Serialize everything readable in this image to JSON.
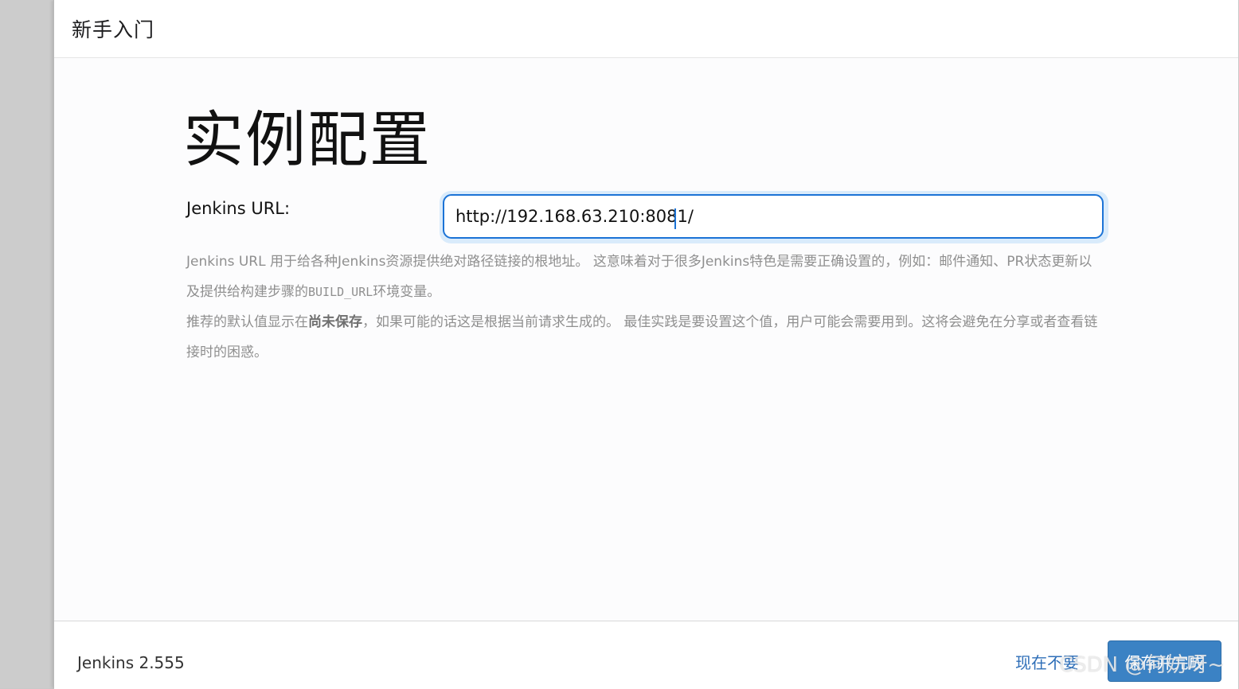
{
  "dialog": {
    "title": "新手入门"
  },
  "page": {
    "heading": "实例配置"
  },
  "form": {
    "url_label": "Jenkins URL:",
    "url_value": "http://192.168.63.210:8081/"
  },
  "help": {
    "line1_a": "Jenkins URL 用于给各种Jenkins资源提供绝对路径链接的根地址。 这意味着对于很多Jenkins特色是需要正确设置的，例如：邮件通知、PR状态更新以及提供给构建步骤的",
    "line1_code": "BUILD_URL",
    "line1_b": "环境变量。",
    "line2_a": "推荐的默认值显示在",
    "line2_bold": "尚未保存",
    "line2_b": "，如果可能的话这是根据当前请求生成的。 最佳实践是要设置这个值，用户可能会需要用到。这将会避免在分享或者查看链接时的困惑。"
  },
  "footer": {
    "version": "Jenkins 2.555",
    "skip_label": "现在不要",
    "save_label": "保存并完成"
  },
  "watermark": "CSDN @何妨呀~"
}
